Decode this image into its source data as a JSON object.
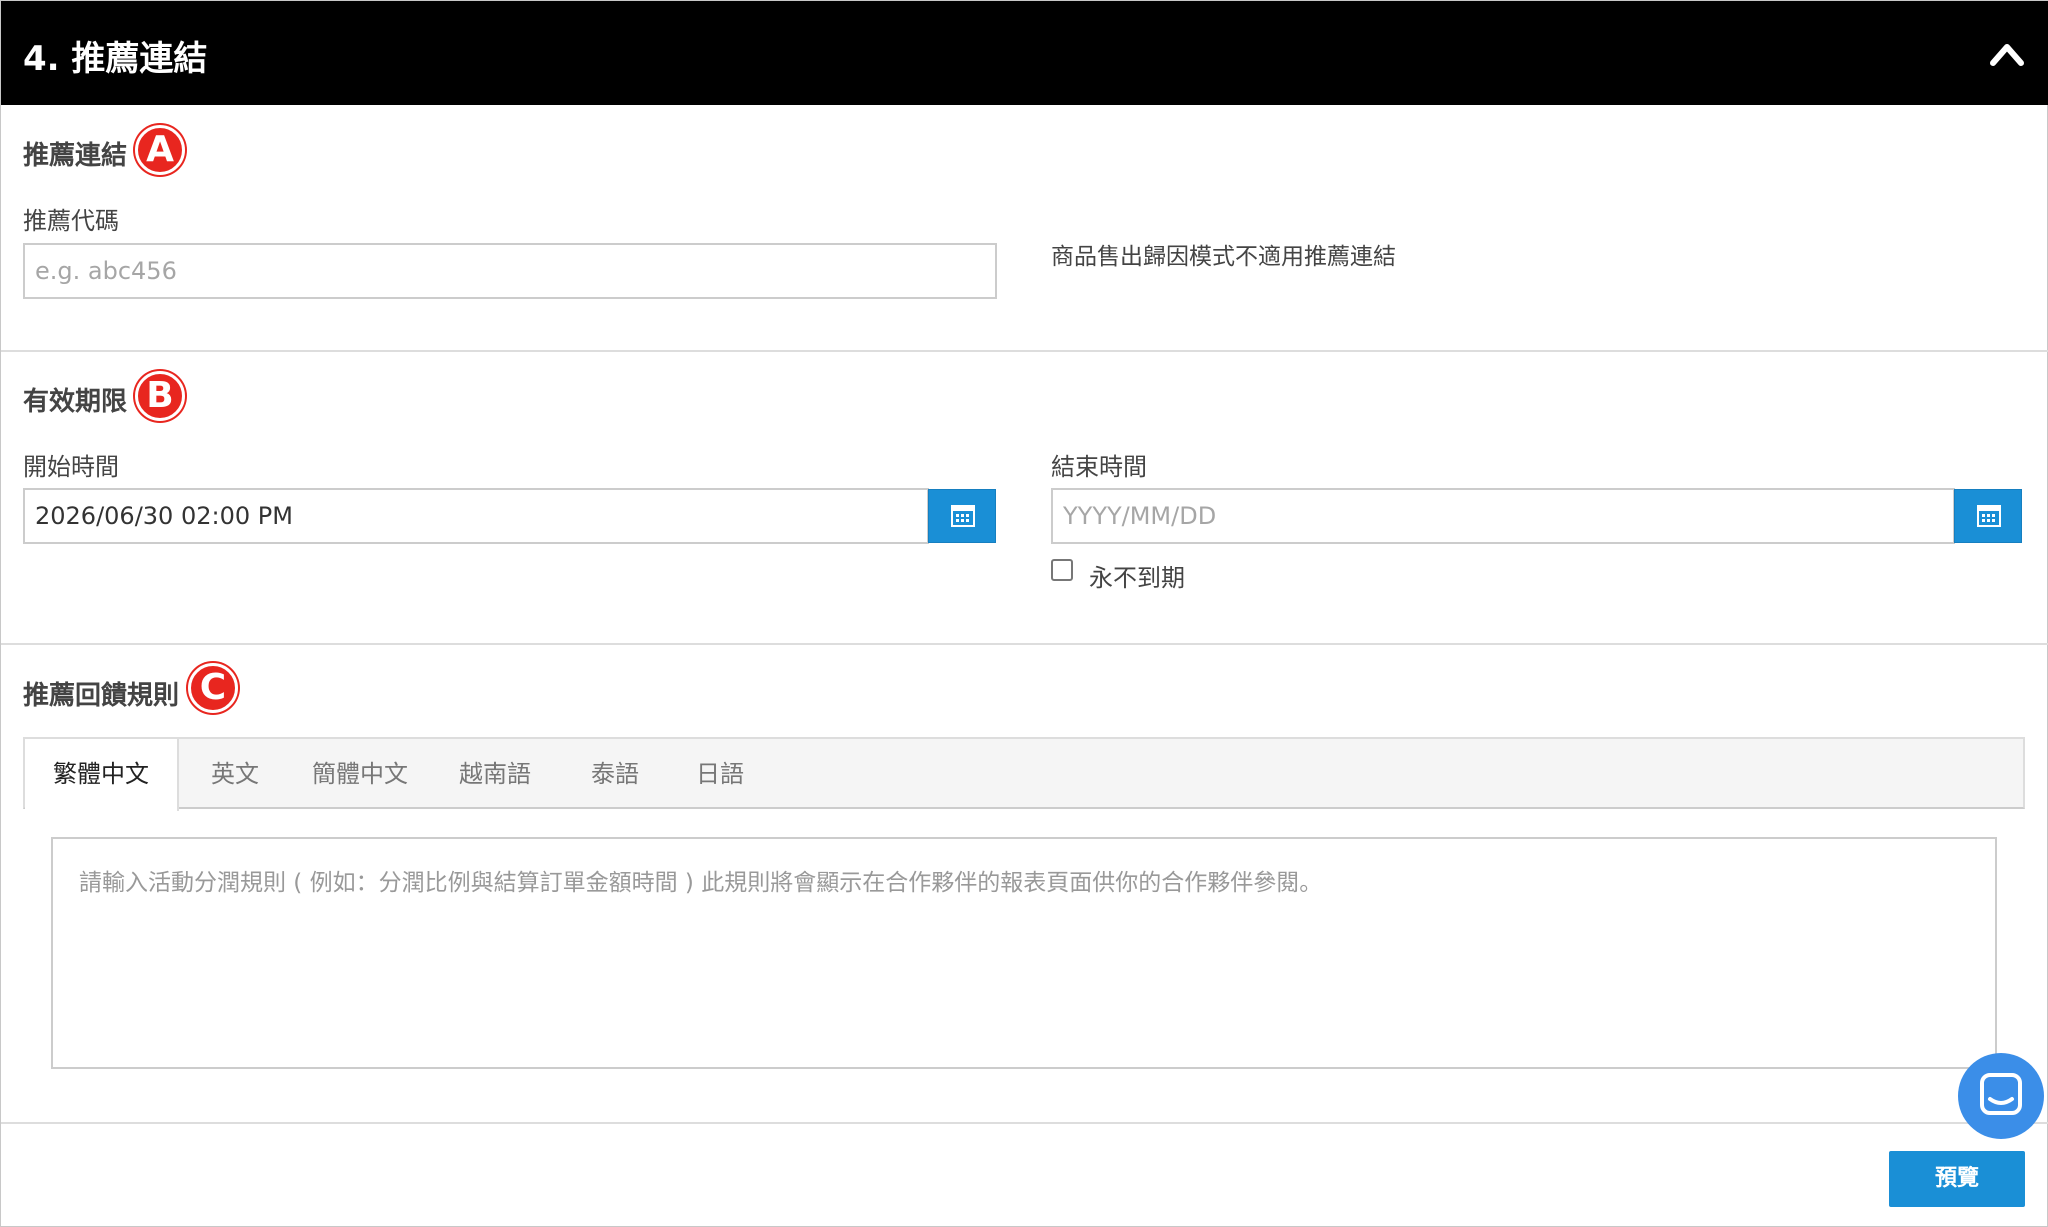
{
  "header": {
    "title": "4. 推薦連結"
  },
  "referral_section": {
    "title": "推薦連結",
    "marker": "A",
    "code_label": "推薦代碼",
    "code_placeholder": "e.g. abc456",
    "note": "商品售出歸因模式不適用推薦連結"
  },
  "validity_section": {
    "title": "有效期限",
    "marker": "B",
    "start_label": "開始時間",
    "start_value": "2026/06/30 02:00 PM",
    "end_label": "結束時間",
    "end_placeholder": "YYYY/MM/DD",
    "never_expire_label": "永不到期",
    "never_expire_checked": false
  },
  "rules_section": {
    "title": "推薦回饋規則",
    "marker": "C",
    "tabs": [
      {
        "label": "繁體中文",
        "active": true
      },
      {
        "label": "英文",
        "active": false
      },
      {
        "label": "簡體中文",
        "active": false
      },
      {
        "label": "越南語",
        "active": false
      },
      {
        "label": "泰語",
        "active": false
      },
      {
        "label": "日語",
        "active": false
      }
    ],
    "textarea_placeholder": "請輸入活動分潤規則 ( 例如：分潤比例與結算訂單金額時間 ) 此規則將會顯示在合作夥伴的報表頁面供你的合作夥伴參閱。"
  },
  "footer": {
    "preview_label": "預覽"
  },
  "colors": {
    "header_bg": "#000000",
    "accent_blue": "#1a8fd6",
    "marker_red": "#e8261f",
    "chat_blue": "#3b8ee8"
  },
  "icons": [
    "chevron-up-icon",
    "calendar-icon",
    "chat-icon"
  ]
}
